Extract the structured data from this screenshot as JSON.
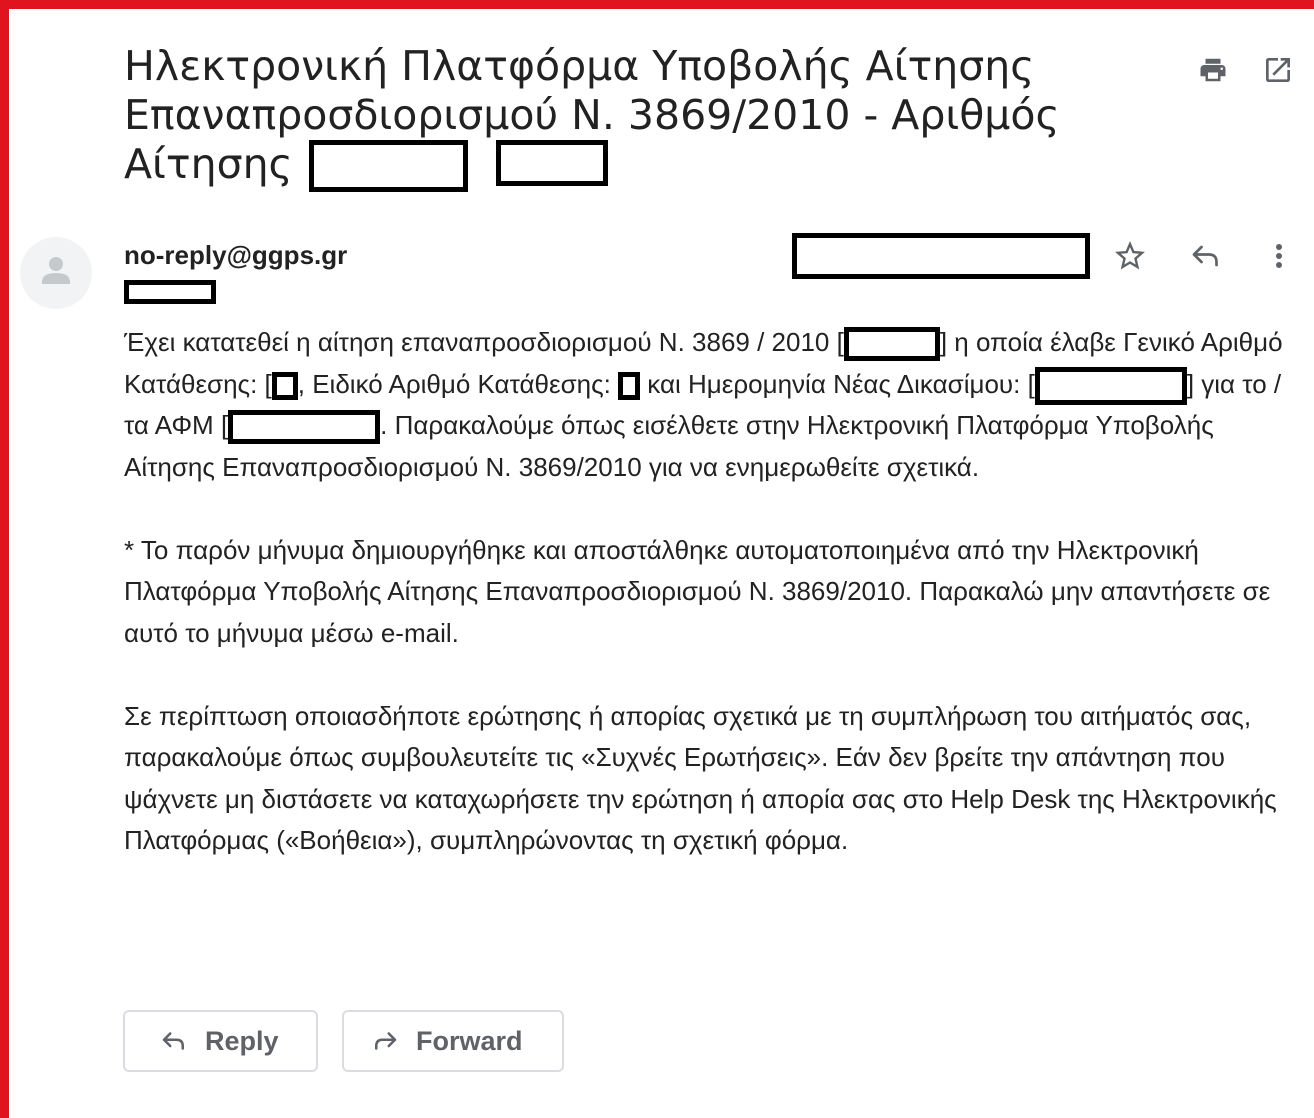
{
  "email": {
    "subject": "Ηλεκτρονική Πλατφόρμα Υποβολής Αίτησης Επαναπροσδιορισμού Ν. 3869/2010 - Αριθμός Αίτησης [",
    "sender": "no-reply@ggps.gr",
    "body": {
      "p1": {
        "a": "Έχει κατατεθεί η αίτηση επαναπροσδιορισμού Ν. 3869 / 2010 [",
        "b": "] η οποία έλαβε Γενικό Αριθμό Κατάθεσης: [",
        "c": ", Ειδικό Αριθμό Κατάθεσης: ",
        "d": " και Ημερομηνία Νέας Δικασίμου: [",
        "e": "] για το / τα ΑΦΜ [",
        "f": ". Παρακαλούμε όπως εισέλθετε στην Ηλεκτρονική Πλατφόρμα Υποβολής Αίτησης Επαναπροσδιορισμού Ν. 3869/2010 για να ενημερωθείτε σχετικά."
      },
      "p2": "* Το παρόν μήνυμα δημιουργήθηκε και αποστάλθηκε αυτοματοποιημένα από την Ηλεκτρονική Πλατφόρμα Υποβολής Αίτησης Επαναπροσδιορισμού Ν. 3869/2010. Παρακαλώ μην απαντήσετε σε αυτό το μήνυμα μέσω e-mail.",
      "p3": "Σε περίπτωση οποιασδήποτε ερώτησης ή απορίας σχετικά με τη συμπλήρωση του αιτήματός σας, παρακαλούμε όπως συμβουλευτείτε τις «Συχνές Ερωτήσεις». Εάν δεν βρείτε την απάντηση που ψάχνετε μη διστάσετε να καταχωρήσετε την ερώτηση ή απορία σας στο Help Desk της Ηλεκτρονικής Πλατφόρμας («Βοήθεια»), συμπληρώνοντας τη σχετική φόρμα."
    }
  },
  "actions": {
    "reply_label": "Reply",
    "forward_label": "Forward"
  },
  "icons": {
    "print": "print-icon",
    "open_new_window": "open-in-new-window-icon",
    "avatar": "default-avatar-icon",
    "star": "star-outline-icon",
    "reply": "reply-arrow-icon",
    "more": "more-vertical-icon",
    "forward": "forward-arrow-icon"
  },
  "colors": {
    "frame_border": "#e0141e",
    "text": "#222222",
    "icon": "#5f6368",
    "button_border": "#dadce0"
  }
}
